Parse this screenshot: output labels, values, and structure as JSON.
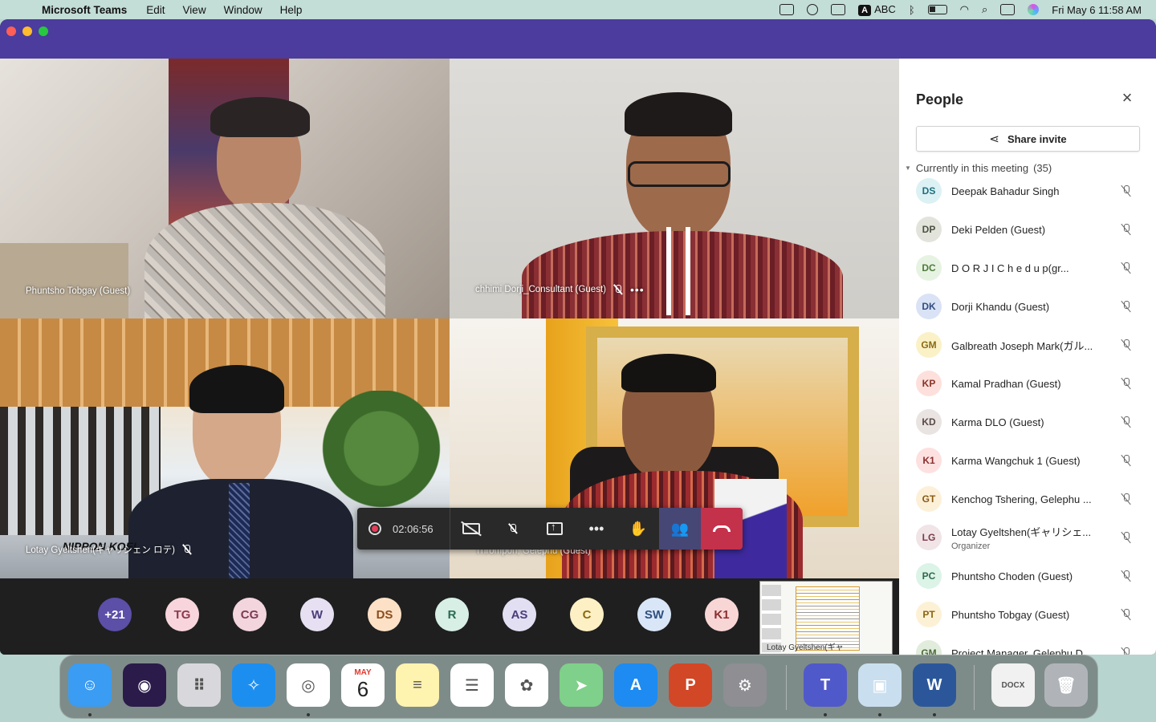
{
  "menubar": {
    "app_name": "Microsoft Teams",
    "menus": [
      "Edit",
      "View",
      "Window",
      "Help"
    ],
    "input_label": "ABC",
    "datetime": "Fri May 6  11:58 AM"
  },
  "video_tiles": [
    {
      "name": "Phuntsho Tobgay (Guest)",
      "muted": false
    },
    {
      "name": "chhimi Dorji_Consultant (Guest)",
      "muted": true
    },
    {
      "name": "Lotay Gyeltshen(ギャリシェン ロテ)",
      "muted": true
    },
    {
      "name": "Thrompon, Gelephu (Guest)",
      "muted": false
    }
  ],
  "tile_text": {
    "nippon_koei": "NIPPON KOEI"
  },
  "controls": {
    "timer": "02:06:56",
    "colors": {
      "bar": "#292929",
      "active": "#464775",
      "hangup": "#c4314b"
    }
  },
  "avatar_strip": [
    {
      "initials": "+21",
      "bg": "#5b4fa8",
      "fg": "#ffffff"
    },
    {
      "initials": "TG",
      "bg": "#f8d5dc",
      "fg": "#8a3a4c"
    },
    {
      "initials": "CG",
      "bg": "#f3d5de",
      "fg": "#7c3b52"
    },
    {
      "initials": "W",
      "bg": "#e6e0f2",
      "fg": "#4a3d7a"
    },
    {
      "initials": "DS",
      "bg": "#fde1c7",
      "fg": "#8a4f1d"
    },
    {
      "initials": "R",
      "bg": "#d7efe5",
      "fg": "#2c6a52"
    },
    {
      "initials": "AS",
      "bg": "#e3dff3",
      "fg": "#4a3d7a"
    },
    {
      "initials": "C",
      "bg": "#fdf0c4",
      "fg": "#8a6a12"
    },
    {
      "initials": "SW",
      "bg": "#d9e6f7",
      "fg": "#2f4f80"
    },
    {
      "initials": "K1",
      "bg": "#f9d6d6",
      "fg": "#8a2f2f"
    }
  ],
  "share_thumb": {
    "label": "Lotay Gyeltshen(ギャ"
  },
  "people_panel": {
    "title": "People",
    "share_invite": "Share invite",
    "section_label": "Currently in this meeting",
    "count": "(35)",
    "participants": [
      {
        "initials": "DS",
        "name": "Deepak Bahadur Singh",
        "role": "",
        "bg": "#dcf1f4",
        "fg": "#1d6f7c"
      },
      {
        "initials": "DP",
        "name": "Deki Pelden (Guest)",
        "role": "",
        "bg": "#e2e4dc",
        "fg": "#4b5240"
      },
      {
        "initials": "DC",
        "name": "D O R J I  C h e d u p(gr...",
        "role": "",
        "bg": "#e7f3e2",
        "fg": "#4f7a3c"
      },
      {
        "initials": "DK",
        "name": "Dorji Khandu (Guest)",
        "role": "",
        "bg": "#d9e3f5",
        "fg": "#334d80"
      },
      {
        "initials": "GM",
        "name": "Galbreath Joseph Mark(ガル...",
        "role": "",
        "bg": "#fbf1c7",
        "fg": "#8a6a12"
      },
      {
        "initials": "KP",
        "name": "Kamal Pradhan (Guest)",
        "role": "",
        "bg": "#fde0dc",
        "fg": "#8a3327"
      },
      {
        "initials": "KD",
        "name": "Karma DLO (Guest)",
        "role": "",
        "bg": "#e9e4e2",
        "fg": "#5a4a44"
      },
      {
        "initials": "K1",
        "name": "Karma Wangchuk 1 (Guest)",
        "role": "",
        "bg": "#fde0e0",
        "fg": "#8a2f2f"
      },
      {
        "initials": "GT",
        "name": "Kenchog Tshering, Gelephu ...",
        "role": "",
        "bg": "#fdf0d9",
        "fg": "#8a5a12"
      },
      {
        "initials": "LG",
        "name": "Lotay Gyeltshen(ギャリシェ...",
        "role": "Organizer",
        "bg": "#f0e4e6",
        "fg": "#7a3b4a"
      },
      {
        "initials": "PC",
        "name": "Phuntsho Choden (Guest)",
        "role": "",
        "bg": "#dcf3e7",
        "fg": "#2c6a4a"
      },
      {
        "initials": "PT",
        "name": "Phuntsho Tobgay (Guest)",
        "role": "",
        "bg": "#fdf1d5",
        "fg": "#8a6412"
      },
      {
        "initials": "GM",
        "name": "Project Manager, Gelephu D...",
        "role": "",
        "bg": "#e2ecdc",
        "fg": "#4b6a3c"
      }
    ]
  },
  "dock": {
    "apps": [
      {
        "icon": "finder-icon",
        "glyph": "☺",
        "bg": "#3a9cf2",
        "running": true
      },
      {
        "icon": "siri-icon",
        "glyph": "◉",
        "bg": "#2b1b4a",
        "running": false
      },
      {
        "icon": "launchpad-icon",
        "glyph": "⠿",
        "bg": "#d8d8dc",
        "running": false
      },
      {
        "icon": "safari-icon",
        "glyph": "✧",
        "bg": "#1c8ef0",
        "running": false
      },
      {
        "icon": "chrome-icon",
        "glyph": "◎",
        "bg": "#ffffff",
        "running": true
      },
      {
        "icon": "calendar-icon",
        "glyph": "6",
        "bg": "#ffffff",
        "running": false
      },
      {
        "icon": "notes-icon",
        "glyph": "≡",
        "bg": "#fff3b0",
        "running": false
      },
      {
        "icon": "reminders-icon",
        "glyph": "☰",
        "bg": "#ffffff",
        "running": false
      },
      {
        "icon": "photos-icon",
        "glyph": "✿",
        "bg": "#ffffff",
        "running": false
      },
      {
        "icon": "maps-icon",
        "glyph": "➤",
        "bg": "#7fd08a",
        "running": false
      },
      {
        "icon": "app-store-icon",
        "glyph": "A",
        "bg": "#1d8bf1",
        "running": false
      },
      {
        "icon": "powerpoint-icon",
        "glyph": "P",
        "bg": "#d24726",
        "running": false
      },
      {
        "icon": "system-preferences-icon",
        "glyph": "⚙",
        "bg": "#8e8e93",
        "running": false
      },
      {
        "icon": "teams-icon",
        "glyph": "T",
        "bg": "#5059c9",
        "running": true
      },
      {
        "icon": "preview-icon",
        "glyph": "▣",
        "bg": "#c9dff0",
        "running": true
      },
      {
        "icon": "word-icon",
        "glyph": "W",
        "bg": "#2b579a",
        "running": true
      },
      {
        "icon": "docx-file-icon",
        "glyph": "DOCX",
        "bg": "#f1f1f1",
        "running": false
      },
      {
        "icon": "trash-icon",
        "glyph": "🗑",
        "bg": "#b0b4b8",
        "running": false
      }
    ],
    "calendar_month": "MAY"
  }
}
